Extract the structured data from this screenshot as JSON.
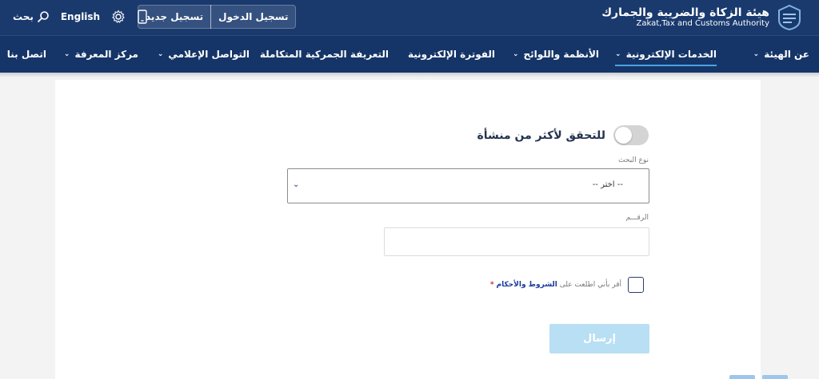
{
  "header": {
    "logo_ar": "هيئة الزكاة والضريبة والجمارك",
    "logo_en": "Zakat,Tax and Customs Authority",
    "login_label": "تسجيل الدخول",
    "register_label": "تسجيل جديد",
    "language_label": "English",
    "search_label": "بحث"
  },
  "nav": {
    "items": [
      {
        "label": "عن الهيئة",
        "dropdown": true
      },
      {
        "label": "الخدمات الإلكترونية",
        "dropdown": true,
        "active": true
      },
      {
        "label": "الأنظمة واللوائح",
        "dropdown": true
      },
      {
        "label": "الفوترة الإلكترونية",
        "dropdown": false
      },
      {
        "label": "التعريفة الجمركية المتكاملة",
        "dropdown": false
      },
      {
        "label": "التواصل الإعلامي",
        "dropdown": true
      },
      {
        "label": "مركز المعرفة",
        "dropdown": true
      },
      {
        "label": "اتصل بنا",
        "dropdown": false
      }
    ]
  },
  "form": {
    "toggle_label": "للتحقق لأكثر من منشأة",
    "toggle_on": false,
    "search_type_label": "نوع البحث",
    "search_type_value": "-- اختر --",
    "number_label": "الرقـــم",
    "number_value": "",
    "terms_prefix": "أقر بأني اطلعت على",
    "terms_link": "الشروط والأحكام",
    "terms_required": "*",
    "submit_label": "إرسال"
  },
  "colors": {
    "header_bg": "#1a3a6e",
    "nav_bg": "#153568",
    "accent": "#4aa3df",
    "submit_disabled": "#b8dff3"
  }
}
